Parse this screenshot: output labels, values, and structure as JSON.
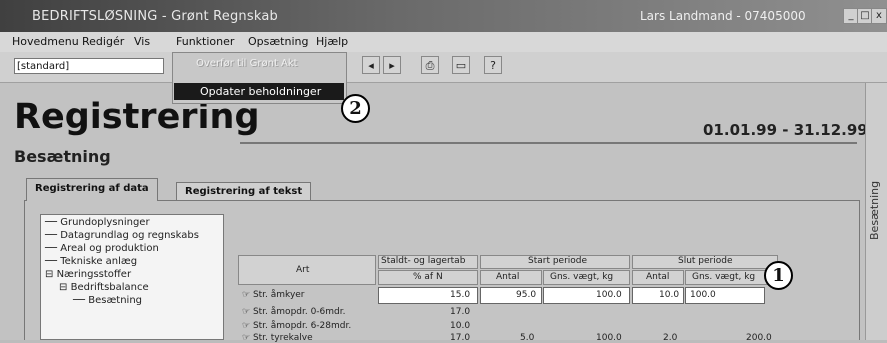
{
  "window": {
    "title": "BEDRIFTSLØSNING - Grønt Regnskab",
    "user": "Lars Landmand - 07405000",
    "controls": [
      "_",
      "□",
      "x"
    ]
  },
  "menubar": [
    "Hovedmenu",
    "Redigér",
    "Vis",
    "Funktioner",
    "Opsætning",
    "Hjælp"
  ],
  "toolbar": {
    "view_combo": "[standard]",
    "buttons": [
      {
        "icon": "arrow-left-icon",
        "glyph": "◂"
      },
      {
        "icon": "arrow-right-icon",
        "glyph": "▸"
      },
      {
        "icon": "print-icon",
        "glyph": "⎙"
      },
      {
        "icon": "screen-icon",
        "glyph": "▭"
      },
      {
        "icon": "help-icon",
        "glyph": "?"
      }
    ]
  },
  "dropdown": {
    "items": [
      "Overfør til Grønt Akt",
      "Opdater beholdninger"
    ],
    "selected": 1
  },
  "markers": [
    "1",
    "2"
  ],
  "page": {
    "title": "Registrering",
    "subtitle": "Besætning",
    "date_range": "01.01.99 - 31.12.99",
    "side_label": "Besætning"
  },
  "tabs": [
    "Registrering af data",
    "Registrering af tekst"
  ],
  "tree": [
    {
      "label": "Grundoplysninger",
      "level": 0
    },
    {
      "label": "Datagrundlag og regnskabs",
      "level": 0
    },
    {
      "label": "Areal og produktion",
      "level": 0
    },
    {
      "label": "Tekniske anlæg",
      "level": 0
    },
    {
      "label": "Næringsstoffer",
      "level": 0,
      "toggle": "⊟"
    },
    {
      "label": "Bedriftsbalance",
      "level": 1,
      "toggle": "⊟"
    },
    {
      "label": "Besætning",
      "level": 2
    }
  ],
  "table": {
    "headers": {
      "art": "Art",
      "group1": "Staldt- og lagertab",
      "group1_sub": "% af N",
      "group2": "Start periode",
      "group3": "Slut periode",
      "antal": "Antal",
      "vaegt": "Gns. vægt, kg"
    },
    "rows": [
      {
        "art": "Str. åmkyer",
        "tab": "15.0",
        "start_antal": "95.0",
        "start_vaegt": "100.0",
        "slut_antal": "10.0",
        "slut_vaegt": "100.0"
      },
      {
        "art": "Str. åmopdr. 0-6mdr.",
        "tab": "17.0",
        "start_antal": "",
        "start_vaegt": "",
        "slut_antal": "",
        "slut_vaegt": ""
      },
      {
        "art": "Str. åmopdr. 6-28mdr.",
        "tab": "10.0",
        "start_antal": "",
        "start_vaegt": "",
        "slut_antal": "",
        "slut_vaegt": ""
      },
      {
        "art": "Str. tyrekalve",
        "tab": "17.0",
        "start_antal": "5.0",
        "start_vaegt": "100.0",
        "slut_antal": "2.0",
        "slut_vaegt": "200.0"
      }
    ]
  }
}
